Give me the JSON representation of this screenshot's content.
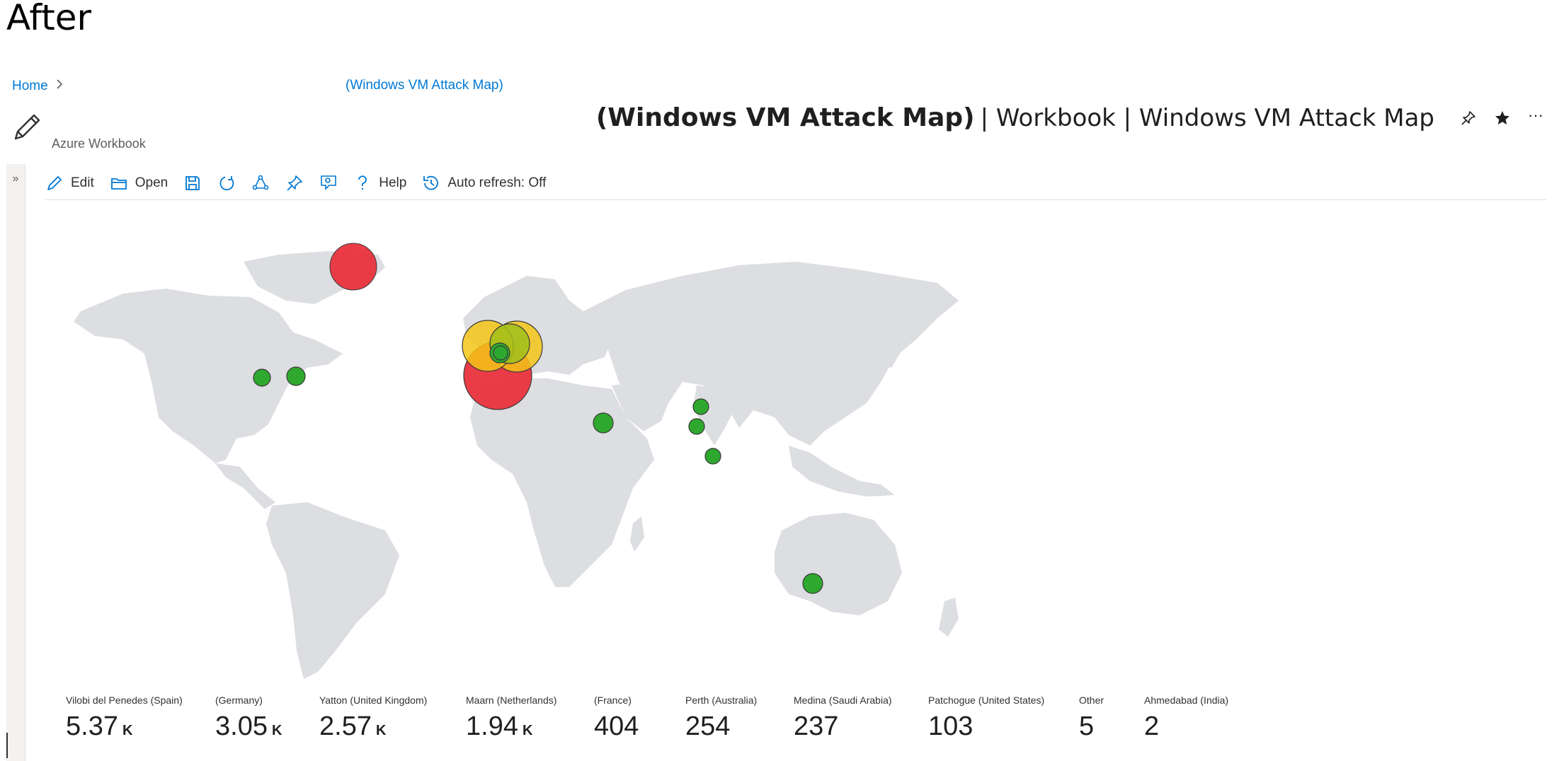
{
  "caption": "After",
  "breadcrumb": {
    "home": "Home",
    "sep": ">",
    "current": "(Windows VM Attack Map)"
  },
  "header": {
    "title_bold": "(Windows VM Attack Map)",
    "title_rest": "| Workbook | Windows VM Attack Map",
    "subtitle": "Azure Workbook",
    "pin_icon": "pin-icon",
    "star_icon": "star-icon",
    "more_label": "···"
  },
  "sidebar": {
    "collapse_label": "»"
  },
  "toolbar": {
    "items": [
      {
        "icon": "edit-icon",
        "label": "Edit"
      },
      {
        "icon": "open-icon",
        "label": "Open"
      },
      {
        "icon": "save-icon",
        "label": ""
      },
      {
        "icon": "refresh-icon",
        "label": ""
      },
      {
        "icon": "share-icon",
        "label": ""
      },
      {
        "icon": "pin-icon",
        "label": ""
      },
      {
        "icon": "feedback-icon",
        "label": ""
      },
      {
        "icon": "help-icon",
        "label": "Help"
      },
      {
        "icon": "history-icon",
        "label": "Auto refresh: Off"
      }
    ]
  },
  "map": {
    "colors": {
      "land": "#dddee1",
      "high": "#e8323c",
      "medium": "#f5c518",
      "mediumlow": "#9fbf1c",
      "low": "#2ea82e"
    },
    "points": [
      {
        "location": "Vilobi del Penedes (Spain)",
        "level": "high"
      },
      {
        "location": "(Germany)",
        "level": "medium"
      },
      {
        "location": "Yatton (United Kingdom)",
        "level": "medium"
      },
      {
        "location": "Maarn (Netherlands)",
        "level": "mediumlow"
      },
      {
        "location": "(France)",
        "level": "low"
      },
      {
        "location": "Perth (Australia)",
        "level": "low"
      },
      {
        "location": "Medina (Saudi Arabia)",
        "level": "low"
      },
      {
        "location": "Patchogue (United States)",
        "level": "low"
      },
      {
        "location": "Other",
        "level": "low"
      },
      {
        "location": "Ahmedabad (India)",
        "level": "low"
      }
    ]
  },
  "tiles": [
    {
      "label": "Vilobi del Penedes (Spain)",
      "value": "5.37",
      "unit": "K"
    },
    {
      "label": "(Germany)",
      "value": "3.05",
      "unit": "K"
    },
    {
      "label": "Yatton (United Kingdom)",
      "value": "2.57",
      "unit": "K"
    },
    {
      "label": "Maarn (Netherlands)",
      "value": "1.94",
      "unit": "K"
    },
    {
      "label": "(France)",
      "value": "404",
      "unit": ""
    },
    {
      "label": "Perth (Australia)",
      "value": "254",
      "unit": ""
    },
    {
      "label": "Medina (Saudi Arabia)",
      "value": "237",
      "unit": ""
    },
    {
      "label": "Patchogue (United States)",
      "value": "103",
      "unit": ""
    },
    {
      "label": "Other",
      "value": "5",
      "unit": ""
    },
    {
      "label": "Ahmedabad (India)",
      "value": "2",
      "unit": ""
    }
  ]
}
